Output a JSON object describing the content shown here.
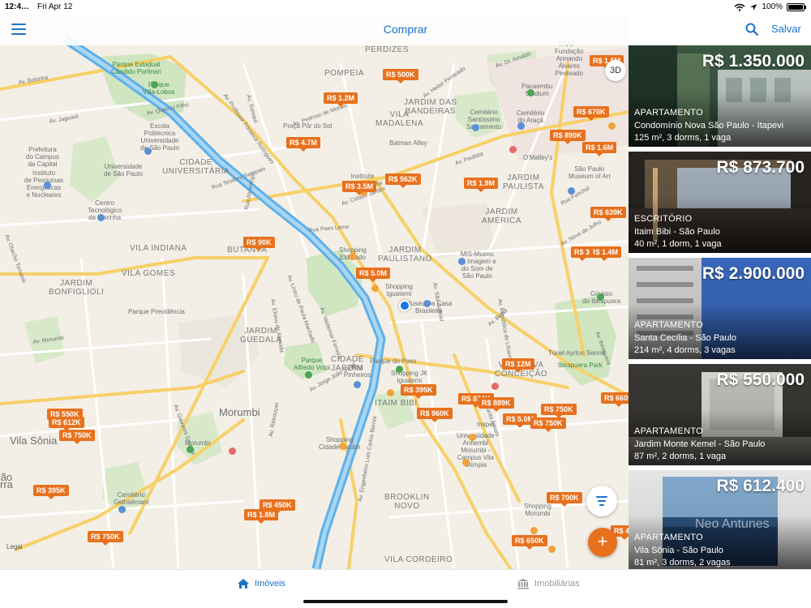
{
  "status_bar": {
    "time": "12:4…",
    "date": "Fri Apr 12",
    "battery": "100%",
    "battery_level": 1.0
  },
  "nav": {
    "title": "Comprar",
    "save_label": "Salvar"
  },
  "map": {
    "btn_3d": "3D",
    "legal": "Legal",
    "price_pins": [
      "R$ 1.5M",
      "R$ 500K",
      "R$ 1.2M",
      "R$ 670K",
      "R$ 890K",
      "R$ 1.6M",
      "R$ 4.7M",
      "R$ 562K",
      "R$ 3.5M",
      "R$ 1.9M",
      "R$ 639K",
      "R$ 90K",
      "R$ 1.4M",
      "R$ 5.0M",
      "R$ 12M",
      "R$ 395K",
      "R$ 874K",
      "R$ 889K",
      "R$ 960K",
      "R$ 750K",
      "R$ 660K",
      "R$ 5.0M",
      "R$ 750K",
      "R$ 550K",
      "R$ 612K",
      "R$ 750K",
      "R$ 395K",
      "R$ 700K",
      "R$ 450K",
      "R$ 1.8M",
      "R$ 750K",
      "R$ 650K",
      "R$ 3",
      "R$ 4M"
    ],
    "labels": {
      "parque_estadual": "Parque Estadual\nCândido Portinari",
      "parque_villa_lobos": "Parque\nVilla-Lobos",
      "perdizes": "PERDIZES",
      "pompeia": "POMPEIA",
      "jardim_das_bandeiras": "JARDIM DAS\nBANDEIRAS",
      "vila_madalena": "VILA\nMADALENA",
      "cemiterio": "Cemitério\nSantíssimo\nSacramento",
      "cemiterio_araca": "Cemitério\ndo Araçá",
      "pacaembu": "Pacaembu\nStadium",
      "faap": "FAAP -\nFundação\nArmando\nÁlvares\nPenteado",
      "largo_arouche": "Largo do Arouche",
      "escola": "Escola\nPolitécnica\nUniversidade\nde São Paulo",
      "praca_por_do_sol": "Praça Pôr do Sol",
      "batman_alley": "Batman Alley",
      "omalleys": "O'Malley's",
      "sao_paulo_museum": "São Paulo\nMuseum of Art",
      "prefeitura": "Prefeitura\ndo Campus\nda Capital",
      "usp": "Universidade\nde São Paulo",
      "cidade_universitaria": "CIDADE\nUNIVERSITÁRIA",
      "instituto_pesquisas": "Instituto\nde Pesquisas\nEnergéticas\ne Nucleares",
      "centro_tecnologico": "Centro\nTecnológico\nda Marinha",
      "instituto_tomie": "Instituto\nTomie Ohtake",
      "jardim_paulista": "JARDIM\nPAULISTA",
      "jardim_america": "JARDIM\nAMÉRICA",
      "vila_indiana": "VILA INDIANA",
      "butanta": "BUTANTÃ",
      "shopping_eldorado": "Shopping\nEldorado",
      "jardim_paulistano": "JARDIM\nPAULISTANO",
      "mis_museu": "MIS-Museu\nda Imagem e\ndo Som de\nSão Paulo",
      "vila_gomes": "VILA GOMES",
      "jardim_bonfiglioli": "JARDIM\nBONFIGLIOLI",
      "parque_previdencia": "Parque Previdência",
      "shopping_iguatemi": "Shopping\nIguatemi",
      "museu_casa": "Museu Da Casa\nBrasileira",
      "ginasio": "Ginásio\ndo Ibirapuera",
      "jardim_guedala": "JARDIM\nGUEDALA",
      "cidade_jardim": "CIDADE\nJARDIM",
      "parque_do_povo": "Parque do Povo",
      "tunel": "Túnel Ayrton Senna",
      "ibirapuera_park": "Ibirapuera Park",
      "parque_alfredo": "Parque\nAlfredo Volpi",
      "rio_pinheiros": "Rio\nPinheiros",
      "shopping_jk": "Shopping JK\nIguatemi",
      "vila_nova": "VILA NOVA\nCONCEIÇÃO",
      "itaim_bibi": "ITAIM BIBI",
      "insper": "Insper",
      "morumbi": "Morumbi",
      "morumbi_park": "Morumbi",
      "vila_sonia": "Vila Sônia",
      "shopping_cidade_jardim": "Shopping\nCidade Jardim",
      "universidade_anhembi": "Universidade\nAnhembi\nMorumbi -\nCampus Vila\nOlímpia",
      "cemiterio_gethsemani": "Cemitério\nGethsêmani",
      "brooklin": "BROOKLIN\nNOVO",
      "shopping_morumbi": "Shopping\nMorumbi",
      "vila_cordeiro": "VILA CORDEIRO",
      "sao_paulo_edge": "ão\nrra",
      "roads": [
        "Av. Bolonha",
        "Av. Jaguaré",
        "Av. Queiroz Filho",
        "Av. Professor Fonseca Rodrigues",
        "Av. Pedroso de Morais",
        "Av. Heitor Penteado",
        "Av. Sumaré",
        "Rua Alvarenga",
        "Rua Paes Leme",
        "Av. Nove de Julho",
        "Av. Eliseu de Almeida",
        "Av. Valdemar Ferreira",
        "Av. Lineu de Paula Machado",
        "Av. Morumbi",
        "Av. Giovanni Gronchi",
        "Av. Jorge João Saad",
        "Av. Brasil",
        "Av. República do Líbano",
        "Av. Santo Amaro",
        "Av. Engenheiro Luís Carlos Berrini",
        "Av. Otacílio Tomanik",
        "Av. Rebouças",
        "Av. Paulista",
        "Av. Dr. Arnaldo",
        "Rua Teodoro Sampaio",
        "Av. São Gabriel",
        "Av. Cidade Jardim",
        "Rua Funchal",
        "Av. Ibirapuera"
      ]
    }
  },
  "listings": [
    {
      "price": "R$ 1.350.000",
      "type": "APARTAMENTO",
      "location": "Condomínio Nova São Paulo - Itapevi",
      "details": "125 m², 3 dorms, 1 vaga",
      "photo_colors": [
        "#2f4636",
        "#5c7a5a",
        "#c9d2cf"
      ]
    },
    {
      "price": "R$ 873.700",
      "type": "ESCRITÓRIO",
      "location": "Itaim Bibi - São Paulo",
      "details": "40 m², 1 dorm, 1 vaga",
      "photo_colors": [
        "#2a2622",
        "#6b5a45",
        "#a9b6c4"
      ]
    },
    {
      "price": "R$ 2.900.000",
      "type": "APARTAMENTO",
      "location": "Santa Cecília - São Paulo",
      "details": "214 m², 4 dorms, 3 vagas",
      "photo_colors": [
        "#1d3f82",
        "#3a6cc4",
        "#d8d8d6"
      ]
    },
    {
      "price": "R$ 550.000",
      "type": "APARTAMENTO",
      "location": "Jardim Monte Kemel - São Paulo",
      "details": "87 m², 2 dorms, 1 vaga",
      "photo_colors": [
        "#3c3a36",
        "#7c7a74",
        "#e1e0da"
      ]
    },
    {
      "price": "R$ 612.400",
      "type": "APARTAMENTO",
      "location": "Vila Sônia - São Paulo",
      "details": "81 m², 3 dorms, 2 vagas",
      "photo_colors": [
        "#f2f2f2",
        "#2f5a86",
        "#88b2d6"
      ],
      "watermark": "Neo Antunes"
    }
  ],
  "tabs": [
    {
      "label": "Imóveis",
      "icon": "home-icon",
      "active": true,
      "color": "#1a73c8"
    },
    {
      "label": "Imobiliárias",
      "icon": "bank-icon",
      "active": false,
      "color": "#9a9a9a"
    }
  ],
  "colors": {
    "accent": "#1a73c8",
    "pin": "#e8711e",
    "map_bg": "#f3efe6",
    "park": "#cfe6c1",
    "highway": "#f7d068",
    "river": "#8ec6ec"
  }
}
